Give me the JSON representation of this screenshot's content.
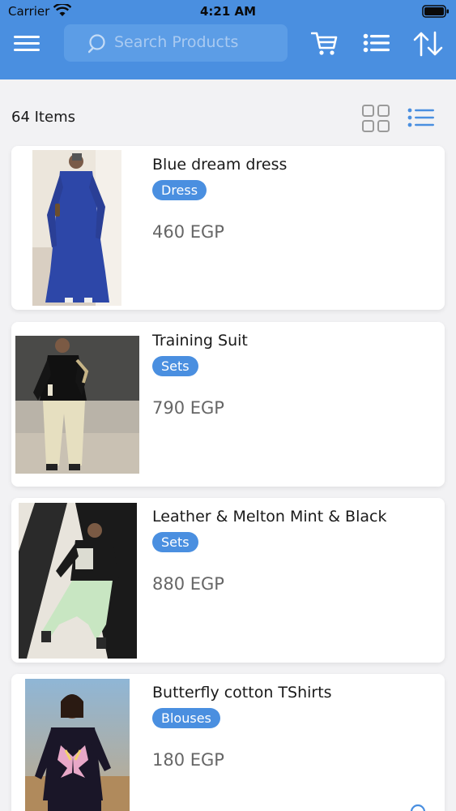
{
  "status_bar": {
    "carrier": "Carrier",
    "time": "4:21 AM"
  },
  "toolbar": {
    "search_placeholder": "Search Products"
  },
  "items": {
    "count_label": "64 Items"
  },
  "products": [
    {
      "name": "Blue dream dress",
      "category": "Dress",
      "price": "460 EGP"
    },
    {
      "name": "Training Suit",
      "category": "Sets",
      "price": "790 EGP"
    },
    {
      "name": "Leather & Melton Mint & Black",
      "category": "Sets",
      "price": "880 EGP"
    },
    {
      "name": "Butterfly cotton TShirts",
      "category": "Blouses",
      "price": "180 EGP"
    }
  ],
  "colors": {
    "primary": "#4a8fe0",
    "background": "#f2f2f4",
    "price_text": "#666666"
  },
  "icons": [
    "menu-icon",
    "search-icon",
    "cart-icon",
    "list-icon",
    "sort-icon",
    "grid-view-icon",
    "list-view-icon",
    "zoom-icon"
  ]
}
